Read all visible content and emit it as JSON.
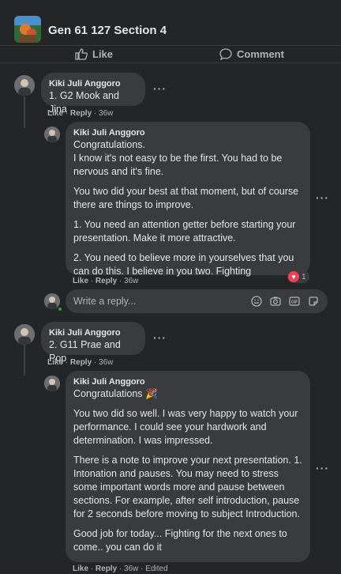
{
  "group": {
    "title": "Gen 61 127 Section 4",
    "avatar": "group-avatar-image"
  },
  "post_actions": {
    "like": "Like",
    "comment": "Comment",
    "like_icon": "thumbs-up-icon",
    "comment_icon": "comment-bubble-icon"
  },
  "comments": [
    {
      "author": "Kiki Juli Anggoro",
      "text": "1. G2 Mook and Jina",
      "like": "Like",
      "reply": "Reply",
      "time": "36w",
      "reply_item": {
        "author": "Kiki Juli Anggoro",
        "paragraphs": [
          "Congratulations.",
          "I know it's not easy to be the first. You had to be nervous and it's fine.",
          "You two did your best at that moment, but of course there are things to improve.",
          "1. You need an attention getter before starting your presentation. Make it more attractive.",
          "2. You need to believe more in yourselves that you can do this. I believe in you two. Fighting"
        ],
        "like": "Like",
        "reply": "Reply",
        "time": "36w",
        "reaction_count": "1",
        "reaction_icon": "heart-icon"
      }
    },
    {
      "author": "Kiki Juli Anggoro",
      "text": "2. G11 Prae and Pop",
      "like": "Like",
      "reply": "Reply",
      "time": "36w",
      "reply_item": {
        "author": "Kiki Juli Anggoro",
        "paragraphs": [
          "Congratulations 🎉",
          "You two did so well. I was very happy to watch your performance. I could see your hardwork and determination. I was impressed.",
          "There is a note to improve your next presentation. 1. Intonation and pauses. You may need to stress some important words more and pause between sections. For example, after self introduction, pause for 2 seconds before moving to subject Introduction.",
          "Good job for today... Fighting for the next ones to come.. you can do it"
        ],
        "like": "Like",
        "reply": "Reply",
        "time": "36w",
        "edited": "Edited"
      }
    }
  ],
  "reply_box": {
    "placeholder": "Write a reply...",
    "icons": [
      "emoji-icon",
      "camera-icon",
      "gif-icon",
      "sticker-icon"
    ]
  },
  "more_icon": "more-options-icon"
}
